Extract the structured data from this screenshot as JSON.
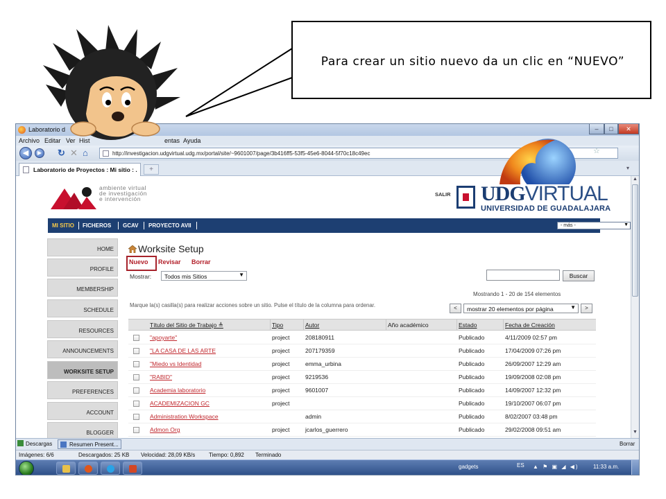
{
  "callout": {
    "text": "Para crear un sitio nuevo da un clic en “NUEVO”"
  },
  "browser": {
    "window_title": "Laboratorio d",
    "window_title_tail": "x",
    "menu": [
      "Archivo",
      "Editar",
      "Ver",
      "Hist",
      "entas",
      "Ayuda"
    ],
    "url": "http://investigacion.udgvirtual.udg.mx/portal/site/~9601007/page/3b416ff5-53f5-45e6-8044-5f70c18c49ec",
    "url_visible": "http://investigacion.udgvirtual.udg.mx/portal/site/~9601007/page/3b416ff5-53f5-45e6-8044-5f70c18c49ec",
    "tab_title": "Laboratorio de Proyectos : Mi sitio : .",
    "new_tab_symbol": "+"
  },
  "header": {
    "logo_line1": "ambiente virtual",
    "logo_line2": "de investigación",
    "logo_line3": "e intervención",
    "salir": "SALIR",
    "udg_bold": "UDG",
    "udg_light": "VIRTUAL",
    "udg_sub": "UNIVERSIDAD DE GUADALAJARA",
    "colors": {
      "navy": "#1d3f72",
      "red": "#c8102e"
    }
  },
  "site_nav": {
    "items": [
      "MI SITIO",
      "FICHEROS",
      "GCAV",
      "PROYECTO AVII"
    ],
    "more_select": "- más -"
  },
  "tool_menu": [
    "HOME",
    "PROFILE",
    "MEMBERSHIP",
    "SCHEDULE",
    "RESOURCES",
    "ANNOUNCEMENTS",
    "WORKSITE SETUP",
    "PREFERENCES",
    "ACCOUNT",
    "BLOGGER"
  ],
  "tool_menu_active": "WORKSITE SETUP",
  "worksite": {
    "title": "Worksite Setup",
    "actions": {
      "nuevo": "Nuevo",
      "revisar": "Revisar",
      "borrar": "Borrar"
    },
    "mostrar_label": "Mostrar:",
    "mostrar_value": "Todos mis Sitios",
    "search_value": "",
    "buscar": "Buscar",
    "showing": "Mostrando 1 - 20 de 154 elementos",
    "instructions": "Marque la(s) casilla(s) para realizar acciones sobre un sitio. Pulse el título de la columna para ordenar.",
    "prev": "<",
    "next": ">",
    "per_page": "mostrar 20 elementos por página"
  },
  "table": {
    "headers": [
      "Título del Sitio de Trabajo ≜",
      "Tipo",
      "Autor",
      "Año académico",
      "Estado",
      "Fecha de Creación"
    ],
    "rows": [
      [
        "\"apoyarte\"",
        "project",
        "208180911",
        "",
        "Publicado",
        "4/11/2009 02:57 pm"
      ],
      [
        "\"LA CASA DE LAS ARTE",
        "project",
        "207179359",
        "",
        "Publicado",
        "17/04/2009 07:26 pm"
      ],
      [
        "\"Miedo vs Identidad",
        "project",
        "emma_urbina",
        "",
        "Publicado",
        "26/09/2007 12:29 am"
      ],
      [
        "\"RABID\"",
        "project",
        "9219536",
        "",
        "Publicado",
        "19/09/2008 02:08 pm"
      ],
      [
        "Academia laboratorio",
        "project",
        "9601007",
        "",
        "Publicado",
        "14/09/2007 12:32 pm"
      ],
      [
        "ACADEMIZACION GC",
        "project",
        "",
        "",
        "Publicado",
        "19/10/2007 06:07 pm"
      ],
      [
        "Administration Workspace",
        "",
        "admin",
        "",
        "Publicado",
        "8/02/2007 03:48 pm"
      ],
      [
        "Admon Org",
        "project",
        "jcarlos_guerrero",
        "",
        "Publicado",
        "29/02/2008 09:51 am"
      ]
    ]
  },
  "downloads": {
    "tab": "Descargas",
    "item": "Resumen Present...",
    "clear": "Borrar"
  },
  "status": {
    "images": "Imágenes: 6/6",
    "downloaded": "Descargados: 25 KB",
    "speed": "Velocidad: 28,09 KB/s",
    "time": "Tiempo: 0,892",
    "done": "Terminado"
  },
  "taskbar": {
    "gadgets": "gadgets",
    "lang": "ES",
    "clock": "11:33 a.m."
  }
}
